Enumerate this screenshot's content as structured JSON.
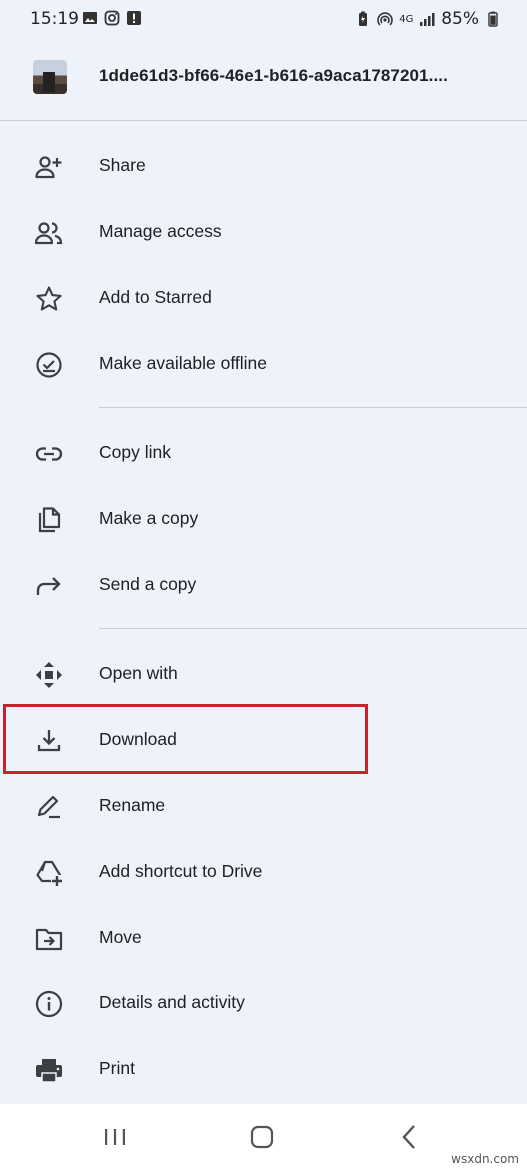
{
  "status_bar": {
    "time": "15:19",
    "network": "4G",
    "battery": "85%",
    "left_icons": [
      "image-icon",
      "instagram-icon",
      "alert-icon"
    ],
    "right_icons": [
      "battery-saver-icon",
      "hotspot-icon",
      "signal-icon",
      "battery-icon"
    ]
  },
  "file": {
    "name": "1dde61d3-bf66-46e1-b616-a9aca1787201...."
  },
  "menu": {
    "share": "Share",
    "manage_access": "Manage access",
    "add_starred": "Add to Starred",
    "offline": "Make available offline",
    "copy_link": "Copy link",
    "make_copy": "Make a copy",
    "send_copy": "Send a copy",
    "open_with": "Open with",
    "download": "Download",
    "rename": "Rename",
    "add_shortcut": "Add shortcut to Drive",
    "move": "Move",
    "details": "Details and activity",
    "print": "Print"
  },
  "highlight_color": "#c8232c",
  "watermark": "wsxdn.com"
}
